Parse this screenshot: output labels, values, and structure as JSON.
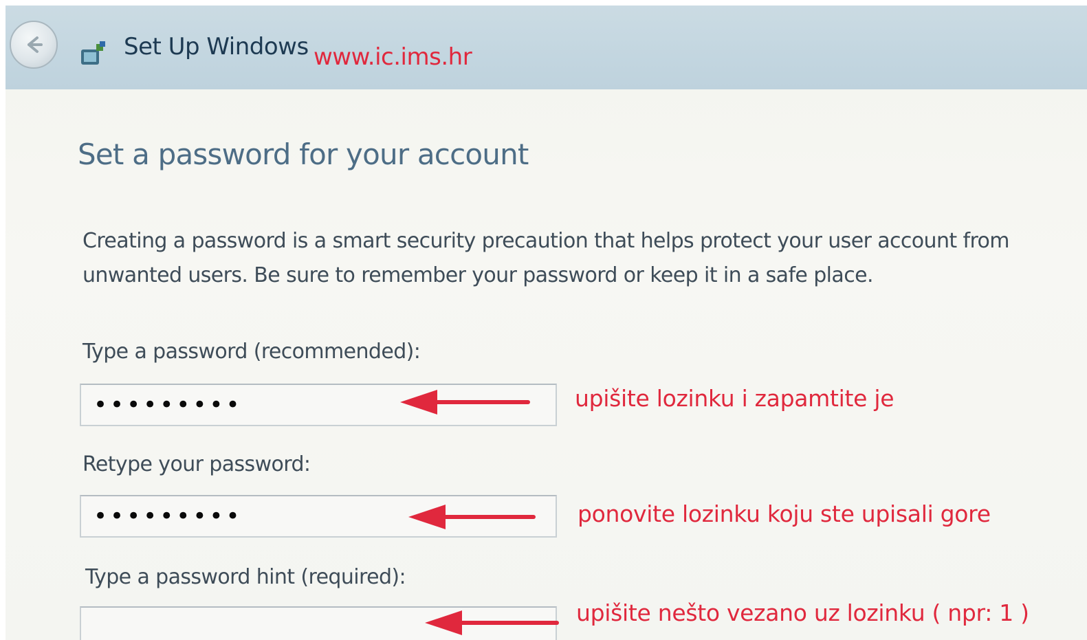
{
  "window": {
    "title": "Set Up Windows",
    "watermark": "www.ic.ims.hr"
  },
  "page": {
    "heading": "Set a password for your account",
    "intro": "Creating a password is a smart security precaution that helps protect your user account from unwanted users. Be sure to remember your password or keep it in a safe place."
  },
  "fields": {
    "password": {
      "label": "Type a password (recommended):",
      "value": "•••••••••"
    },
    "retype": {
      "label": "Retype your password:",
      "value": "•••••••••"
    },
    "hint": {
      "label": "Type a password hint (required):",
      "value": ""
    }
  },
  "annotations": {
    "password": "upišite lozinku i zapamtite je",
    "retype": "ponovite lozinku koju ste upisali gore",
    "hint": "upišite nešto vezano uz lozinku ( npr: 1 )"
  },
  "colors": {
    "annotation": "#e0283d",
    "heading": "#4d6d86",
    "titlebar": "#c3d6e0"
  },
  "icons": {
    "back": "back-arrow-icon",
    "app": "windows-setup-icon"
  }
}
